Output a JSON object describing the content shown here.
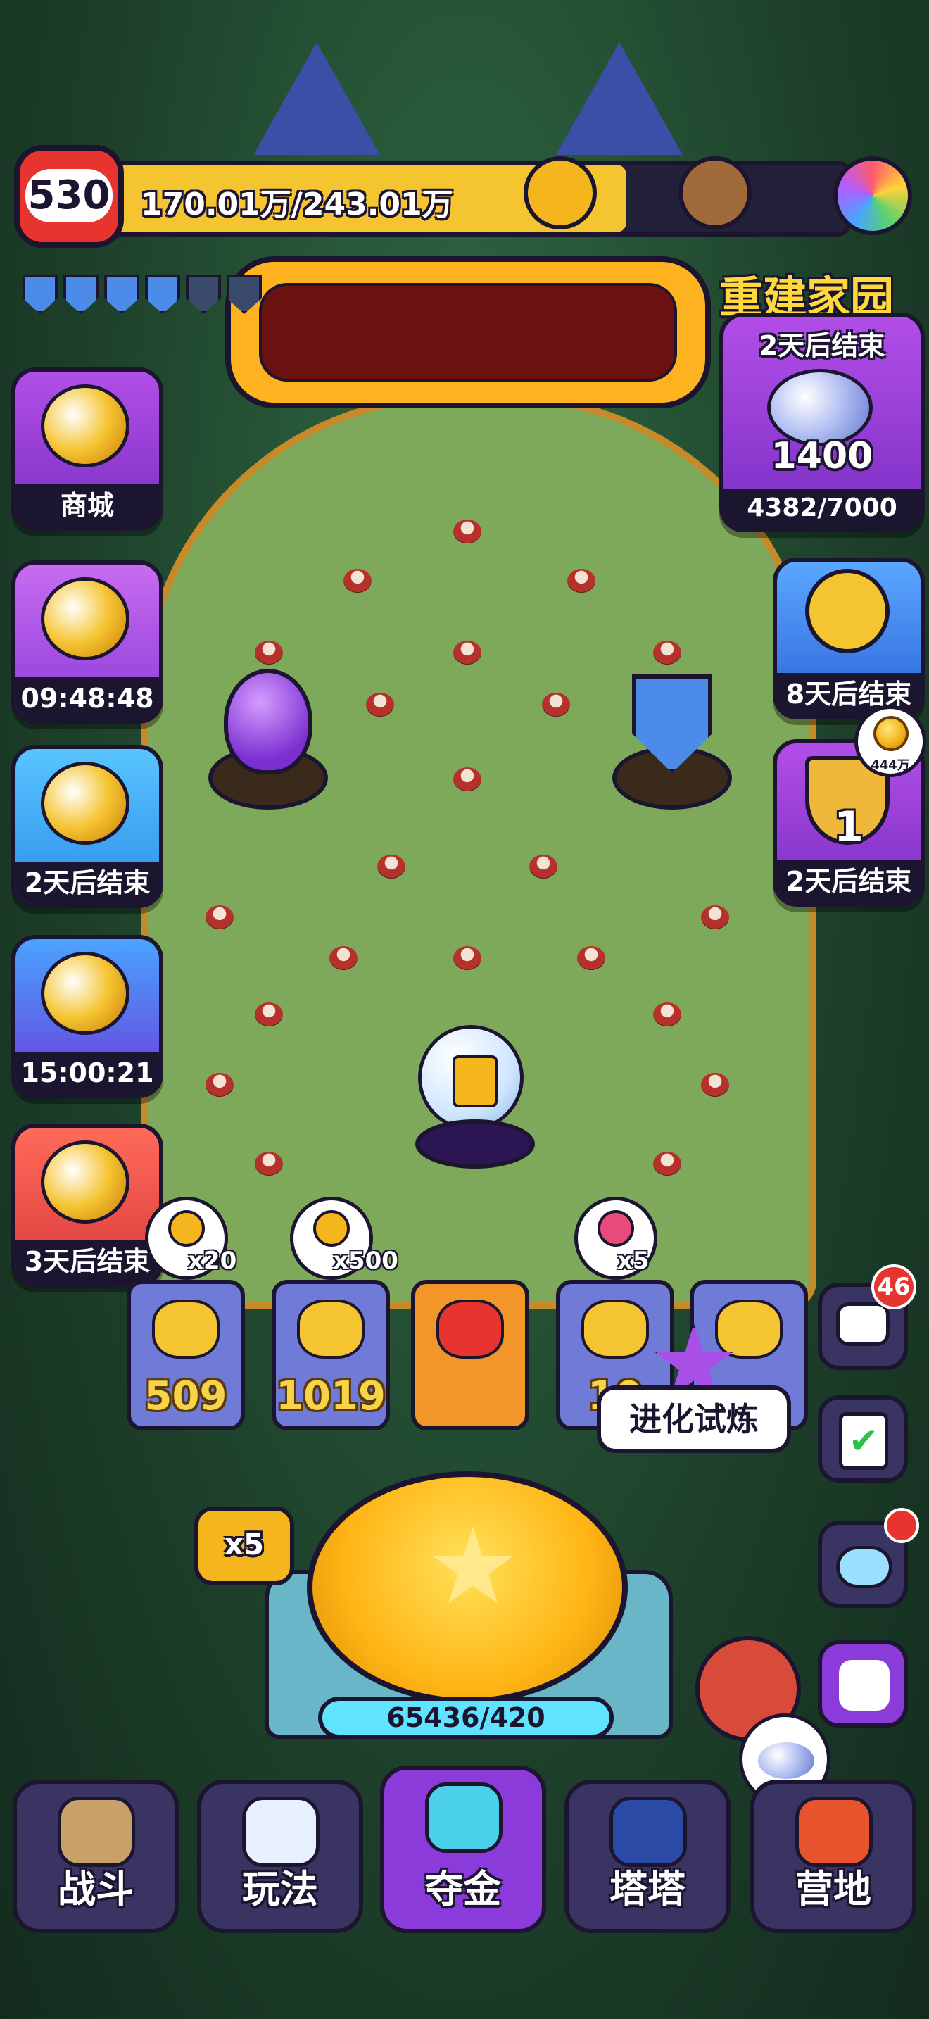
{
  "colors": {
    "field": "#7ea85a",
    "forest": "#1d3f2a",
    "accent": "#f5b51c",
    "purple": "#8a3bd9",
    "frame": "#1c1530"
  },
  "header": {
    "level": "530",
    "xp": "170.01万/243.01万",
    "xp_progress": 0.7,
    "icons": [
      "lightning-upgrade-icon",
      "pickaxe-upgrade-icon",
      "rainbow-upgrade-icon"
    ]
  },
  "shields": {
    "filled": 4,
    "total": 6
  },
  "event_banner": {
    "title": "重建家园",
    "timer": "2天后结束",
    "value": "1400",
    "progress": "4382/7000"
  },
  "left_menu": [
    {
      "id": "shop",
      "label": "商城",
      "icon": "gem-basket-icon"
    },
    {
      "id": "gem-pack",
      "label": "09:48:48",
      "icon": "gem-pack-icon"
    },
    {
      "id": "coin-event",
      "label": "2天后结束",
      "icon": "monkey-coin-icon"
    },
    {
      "id": "wheel",
      "label": "15:00:21",
      "icon": "lucky-wheel-icon"
    },
    {
      "id": "calendar",
      "label": "3天后结束",
      "icon": "calendar-7-icon"
    }
  ],
  "right_menu": [
    {
      "id": "cat-event",
      "label": "8天后结束",
      "icon": "cat-medal-icon"
    },
    {
      "id": "trophy",
      "label": "2天后结束",
      "rank": "1",
      "badge": "444万",
      "icon": "trophy-icon"
    }
  ],
  "slots": [
    {
      "value": "509",
      "bubble": "x20",
      "bubble_icon": "screw-icon"
    },
    {
      "value": "1019",
      "bubble": "x500",
      "bubble_icon": "coin-icon"
    },
    {
      "value": "",
      "bubble": "",
      "bubble_icon": "mystery-box-icon"
    },
    {
      "value": "10",
      "bubble": "x5",
      "bubble_icon": "battery-icon"
    },
    {
      "value": "",
      "bubble": "",
      "bubble_icon": ""
    }
  ],
  "evolution": {
    "label": "进化试炼"
  },
  "launch": {
    "multiplier": "x5",
    "counter": "65436/420"
  },
  "right_tools": {
    "chat_badge": "46"
  },
  "nav": [
    {
      "id": "battle",
      "label": "战斗",
      "icon": "crossed-swords-icon"
    },
    {
      "id": "gameplay",
      "label": "玩法",
      "icon": "gamepad-icon"
    },
    {
      "id": "gold",
      "label": "夺金",
      "icon": "faces-icon",
      "active": true
    },
    {
      "id": "tata",
      "label": "塔塔",
      "icon": "cat-helmet-icon"
    },
    {
      "id": "camp",
      "label": "营地",
      "icon": "tent-icon"
    }
  ]
}
